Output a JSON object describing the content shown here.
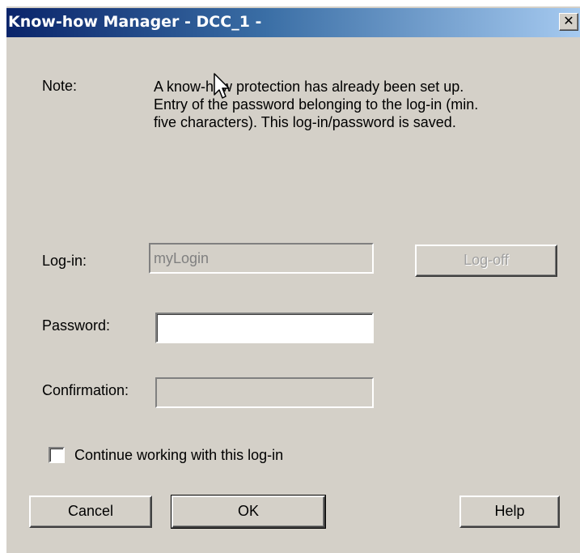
{
  "window": {
    "title": "Know-how Manager - DCC_1 -",
    "close_glyph": "✕"
  },
  "note": {
    "label": "Note:",
    "lines": [
      "A know-how protection has already been set up.",
      "Entry of the password belonging to the log-in (min.",
      "five characters). This log-in/password is saved."
    ]
  },
  "form": {
    "login_label": "Log-in:",
    "login_value": "myLogin",
    "logoff_label": "Log-off",
    "password_label": "Password:",
    "password_value": "",
    "confirmation_label": "Confirmation:",
    "confirmation_value": "",
    "continue_label": "Continue working with this log-in",
    "continue_checked": false
  },
  "buttons": {
    "cancel": "Cancel",
    "ok": "OK",
    "help": "Help"
  },
  "colors": {
    "dialog_bg": "#d4d0c8",
    "title_start": "#0a246a",
    "title_end": "#a6caf0"
  }
}
